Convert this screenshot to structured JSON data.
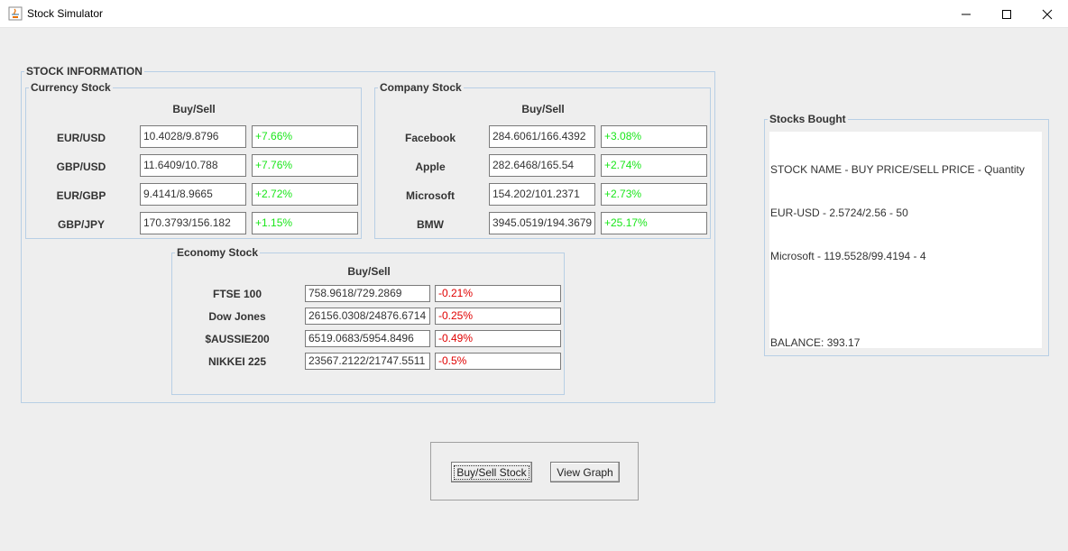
{
  "window": {
    "title": "Stock Simulator"
  },
  "stock_info": {
    "title": "STOCK INFORMATION",
    "currency": {
      "title": "Currency Stock",
      "header": "Buy/Sell",
      "rows": [
        {
          "name": "EUR/USD",
          "price": "10.4028/9.8796",
          "change": "+7.66%"
        },
        {
          "name": "GBP/USD",
          "price": "11.6409/10.788",
          "change": "+7.76%"
        },
        {
          "name": "EUR/GBP",
          "price": "9.4141/8.9665",
          "change": "+2.72%"
        },
        {
          "name": "GBP/JPY",
          "price": "170.3793/156.182",
          "change": "+1.15%"
        }
      ]
    },
    "company": {
      "title": "Company Stock",
      "header": "Buy/Sell",
      "rows": [
        {
          "name": "Facebook",
          "price": "284.6061/166.4392",
          "change": "+3.08%"
        },
        {
          "name": "Apple",
          "price": "282.6468/165.54",
          "change": "+2.74%"
        },
        {
          "name": "Microsoft",
          "price": "154.202/101.2371",
          "change": "+2.73%"
        },
        {
          "name": "BMW",
          "price": "3945.0519/194.3679",
          "change": "+25.17%"
        }
      ]
    },
    "economy": {
      "title": "Economy Stock",
      "header": "Buy/Sell",
      "rows": [
        {
          "name": "FTSE 100",
          "price": "758.9618/729.2869",
          "change": "-0.21%"
        },
        {
          "name": "Dow Jones",
          "price": "26156.0308/24876.6714",
          "change": "-0.25%"
        },
        {
          "name": "$AUSSIE200",
          "price": "6519.0683/5954.8496",
          "change": "-0.49%"
        },
        {
          "name": "NIKKEI 225",
          "price": "23567.2122/21747.5511",
          "change": "-0.5%"
        }
      ]
    }
  },
  "stocks_bought": {
    "title": "Stocks Bought",
    "lines": [
      "STOCK NAME - BUY PRICE/SELL PRICE - Quantity",
      "EUR-USD - 2.5724/2.56 - 50",
      "Microsoft - 119.5528/99.4194 - 4",
      "",
      "BALANCE: 393.17"
    ]
  },
  "buttons": {
    "buy_sell": "Buy/Sell Stock",
    "view_graph": "View Graph"
  },
  "colors": {
    "positive": "#19e619",
    "negative": "#e00000",
    "border": "#b8cfe5"
  }
}
